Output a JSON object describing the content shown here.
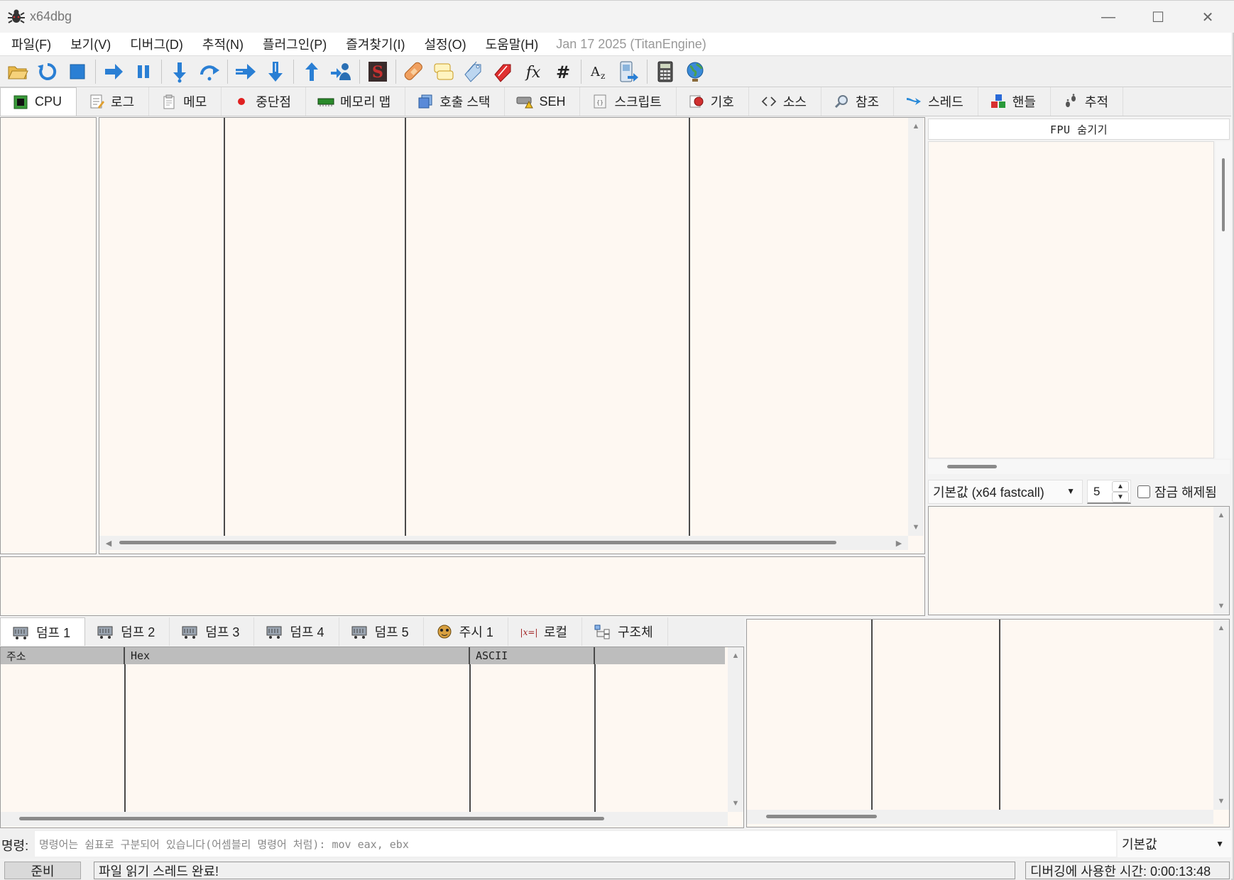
{
  "window": {
    "title": "x64dbg",
    "minimize_glyph": "—",
    "maximize_glyph": "☐",
    "close_glyph": "✕"
  },
  "menu": {
    "items": [
      "파일(F)",
      "보기(V)",
      "디버그(D)",
      "추적(N)",
      "플러그인(P)",
      "즐겨찾기(I)",
      "설정(O)",
      "도움말(H)"
    ],
    "build_info": "Jan 17 2025 (TitanEngine)"
  },
  "toolbar": {
    "buttons": [
      "open-icon",
      "restart-icon",
      "stop-icon",
      "sep",
      "run-icon",
      "pause-icon",
      "sep",
      "step-into-icon",
      "step-over-icon",
      "sep",
      "trace-into-icon",
      "trace-over-icon",
      "sep",
      "execute-till-return-icon",
      "run-to-user-code-icon",
      "sep",
      "scylla-icon",
      "sep",
      "patches-icon",
      "comments-icon",
      "labels-icon",
      "bookmarks-icon",
      "functions-icon",
      "hash-icon",
      "sep",
      "strings-icon",
      "calls-icon",
      "sep",
      "calculator-icon",
      "web-icon"
    ]
  },
  "main_tabs": [
    {
      "label": "CPU",
      "icon": "cpu-icon",
      "active": true
    },
    {
      "label": "로그",
      "icon": "log-icon"
    },
    {
      "label": "메모",
      "icon": "notes-icon"
    },
    {
      "label": "중단점",
      "icon": "breakpoint-icon"
    },
    {
      "label": "메모리 맵",
      "icon": "memory-map-icon"
    },
    {
      "label": "호출 스택",
      "icon": "call-stack-icon"
    },
    {
      "label": "SEH",
      "icon": "seh-icon"
    },
    {
      "label": "스크립트",
      "icon": "script-icon"
    },
    {
      "label": "기호",
      "icon": "symbols-icon"
    },
    {
      "label": "소스",
      "icon": "source-icon"
    },
    {
      "label": "참조",
      "icon": "references-icon"
    },
    {
      "label": "스레드",
      "icon": "threads-icon"
    },
    {
      "label": "핸들",
      "icon": "handles-icon"
    },
    {
      "label": "추적",
      "icon": "trace-icon"
    }
  ],
  "registers": {
    "fpu_toggle_label": "FPU 숨기기",
    "calling_convention": "기본값 (x64 fastcall)",
    "arg_count": "5",
    "unlock_label": "잠금 해제됨"
  },
  "dump_tabs": [
    {
      "label": "덤프 1",
      "icon": "dump-icon",
      "active": true
    },
    {
      "label": "덤프 2",
      "icon": "dump-icon"
    },
    {
      "label": "덤프 3",
      "icon": "dump-icon"
    },
    {
      "label": "덤프 4",
      "icon": "dump-icon"
    },
    {
      "label": "덤프 5",
      "icon": "dump-icon"
    },
    {
      "label": "주시 1",
      "icon": "watch-icon"
    },
    {
      "label": "로컬",
      "icon": "locals-icon"
    },
    {
      "label": "구조체",
      "icon": "struct-icon"
    }
  ],
  "dump_columns": [
    "주소",
    "Hex",
    "ASCII",
    ""
  ],
  "command": {
    "label": "명령:",
    "placeholder": "명령어는 쉼표로 구분되어 있습니다(어셈블리 명령어 처럼): mov eax, ebx",
    "mode": "기본값"
  },
  "status": {
    "state": "준비",
    "message": "파일 읽기 스레드 완료!",
    "time_elapsed": "디버깅에 사용한 시간: 0:00:13:48"
  },
  "colors": {
    "pane_bg": "#fef8f2",
    "column_line": "#4a4a4a",
    "header_bg": "#bdbdbd"
  }
}
